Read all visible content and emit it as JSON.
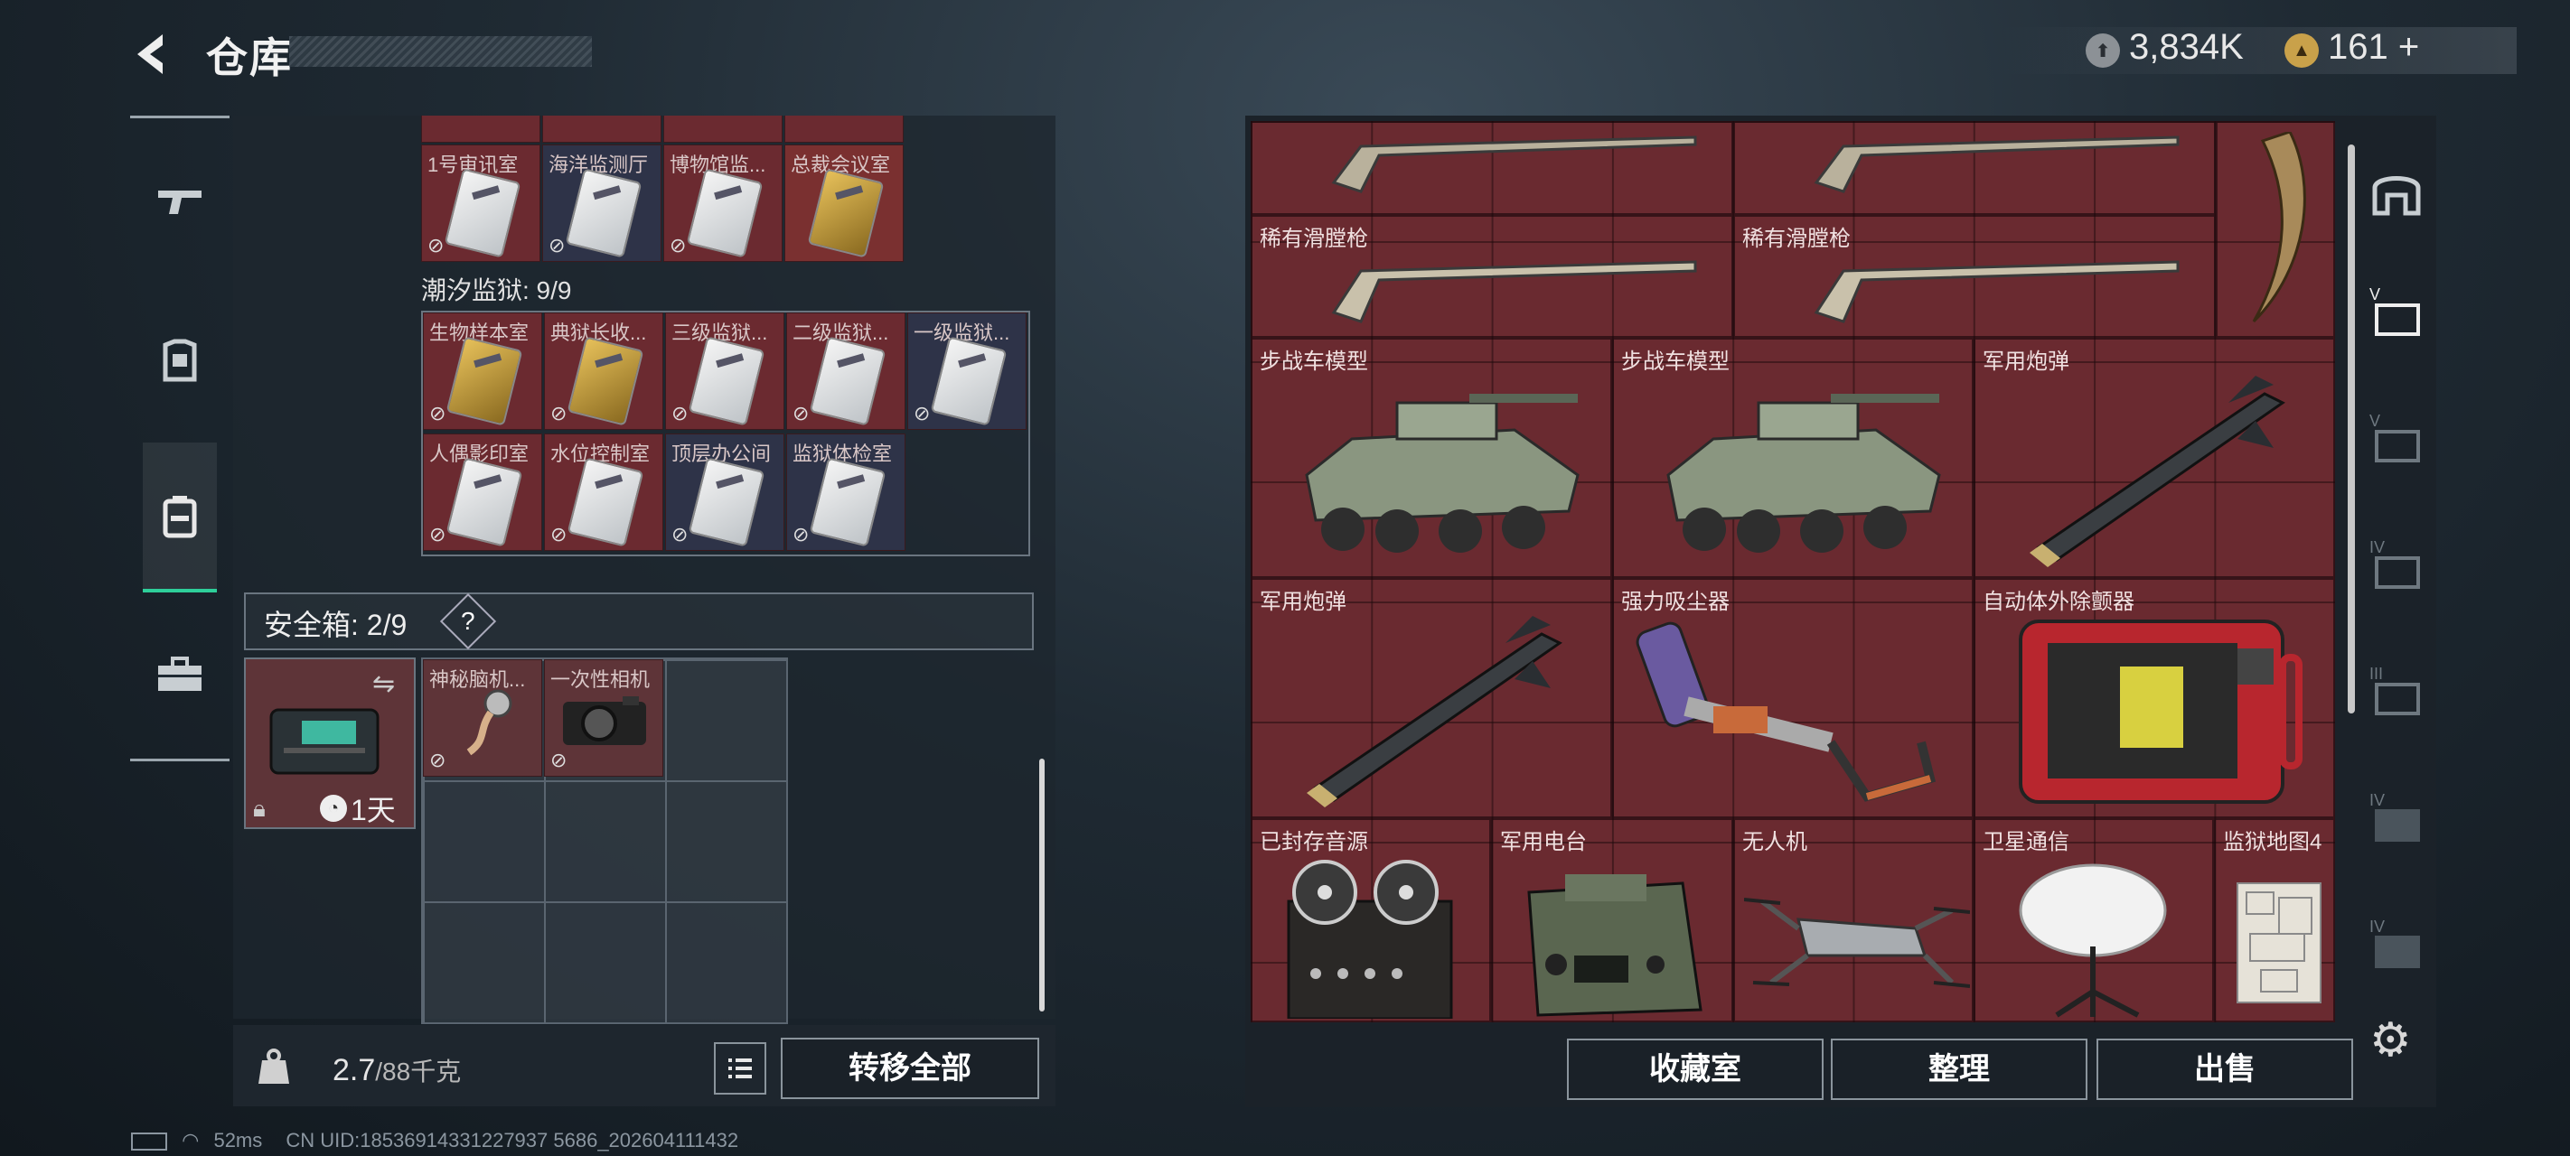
{
  "header": {
    "title": "仓库",
    "coin1_value": "3,834K",
    "coin2_value": "161",
    "coin2_plus": "+"
  },
  "left_nav": {
    "items": [
      {
        "name": "weapons-icon",
        "glyph": "▬"
      },
      {
        "name": "armor-icon",
        "glyph": "▣"
      },
      {
        "name": "backpack-icon",
        "glyph": "▤"
      },
      {
        "name": "case-icon",
        "glyph": "▦"
      }
    ]
  },
  "keycards_top_row": [
    "1号审讯室",
    "海洋监测厅",
    "博物馆监...",
    "总裁会议室"
  ],
  "prison": {
    "label": "潮汐监狱: 9/9",
    "row1": [
      "生物样本室",
      "典狱长收...",
      "三级监狱...",
      "二级监狱...",
      "一级监狱..."
    ],
    "row2": [
      "人偶影印室",
      "水位控制室",
      "顶层办公间",
      "监狱体检室"
    ]
  },
  "safebox": {
    "label": "安全箱: 2/9",
    "help": "?",
    "timer": "1天",
    "items": [
      "神秘脑机...",
      "一次性相机"
    ]
  },
  "bottom_left": {
    "weight": "2.7",
    "weight_max": "/88千克",
    "transfer_label": "转移全部"
  },
  "status_bar": {
    "ping": "52ms",
    "uid": "CN UID:18536914331227937 5686_202604111432"
  },
  "stash_items": [
    {
      "label": "稀有滑膛枪"
    },
    {
      "label": "稀有滑膛枪"
    },
    {
      "label": "步战车模型"
    },
    {
      "label": "步战车模型"
    },
    {
      "label": "军用炮弹"
    },
    {
      "label": "军用炮弹"
    },
    {
      "label": "强力吸尘器"
    },
    {
      "label": "自动体外除颤器"
    },
    {
      "label": "已封存音源"
    },
    {
      "label": "军用电台"
    },
    {
      "label": "无人机"
    },
    {
      "label": "卫星通信"
    },
    {
      "label": "监狱地图4"
    }
  ],
  "right_buttons": {
    "collection": "收藏室",
    "sort": "整理",
    "sell": "出售"
  },
  "right_tabs": [
    "V",
    "V",
    "IV",
    "III",
    "IV",
    "IV"
  ]
}
